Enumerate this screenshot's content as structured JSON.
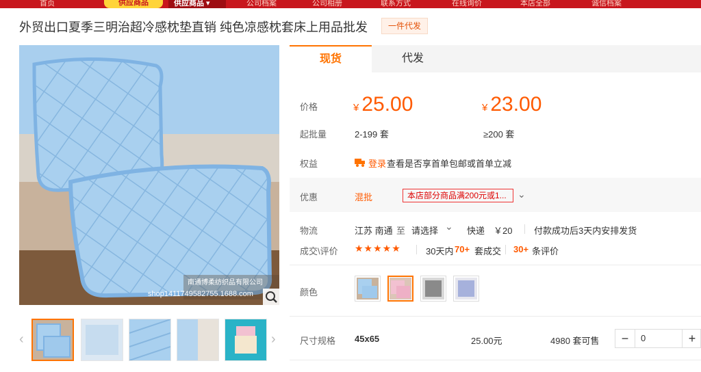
{
  "nav": {
    "items": [
      "首页",
      "供应商品",
      "公司档案",
      "公司相册",
      "联系方式",
      "在线询价",
      "本店全部",
      "诚信档案"
    ],
    "promo": "供应商品",
    "active": "供应商品 ▾"
  },
  "product": {
    "title": "外贸出口夏季三明治超冷感枕垫直销 纯色凉感枕套床上用品批发",
    "badge": "一件代发"
  },
  "gallery": {
    "watermark_line1": "南通博柔纺织品有限公司",
    "watermark_line2": "shop1411749582755.1688.com",
    "prev": "‹",
    "next": "›"
  },
  "tabs": [
    {
      "label": "现货"
    },
    {
      "label": "代发"
    }
  ],
  "pricing": {
    "label": "价格",
    "currency": "¥",
    "tiers": [
      {
        "price": "25.00",
        "qty": "2-199 套"
      },
      {
        "price": "23.00",
        "qty": "≥200 套"
      }
    ],
    "moq_label": "起批量"
  },
  "benefits": {
    "label": "权益",
    "login": "登录",
    "text": "查看是否享首单包邮或首单立减"
  },
  "discount": {
    "label": "优惠",
    "type": "混批",
    "tag": "本店部分商品满200元或1...",
    "chevron": "⌄"
  },
  "logistics": {
    "label": "物流",
    "origin": "江苏 南通",
    "to": "至",
    "dest": "请选择",
    "express": "快递",
    "fee": "￥20",
    "ship_note": "付款成功后3天内安排发货"
  },
  "reviews": {
    "label": "成交\\评价",
    "stars": "★★★★★",
    "period": "30天内",
    "sold_count": "70+",
    "sold_suffix": "套成交",
    "review_count": "30+",
    "review_suffix": "条评价"
  },
  "color": {
    "label": "颜色",
    "swatches": [
      "blue",
      "pink",
      "grey",
      "blue-purple"
    ]
  },
  "size": {
    "label": "尺寸规格",
    "value": "45x65",
    "price": "25.00元",
    "stock": "4980 套可售",
    "minus": "−",
    "plus": "+",
    "quantity": "0"
  },
  "colors": {
    "accent": "#ff7300",
    "price": "#ff5a00",
    "nav": "#c8161d"
  }
}
